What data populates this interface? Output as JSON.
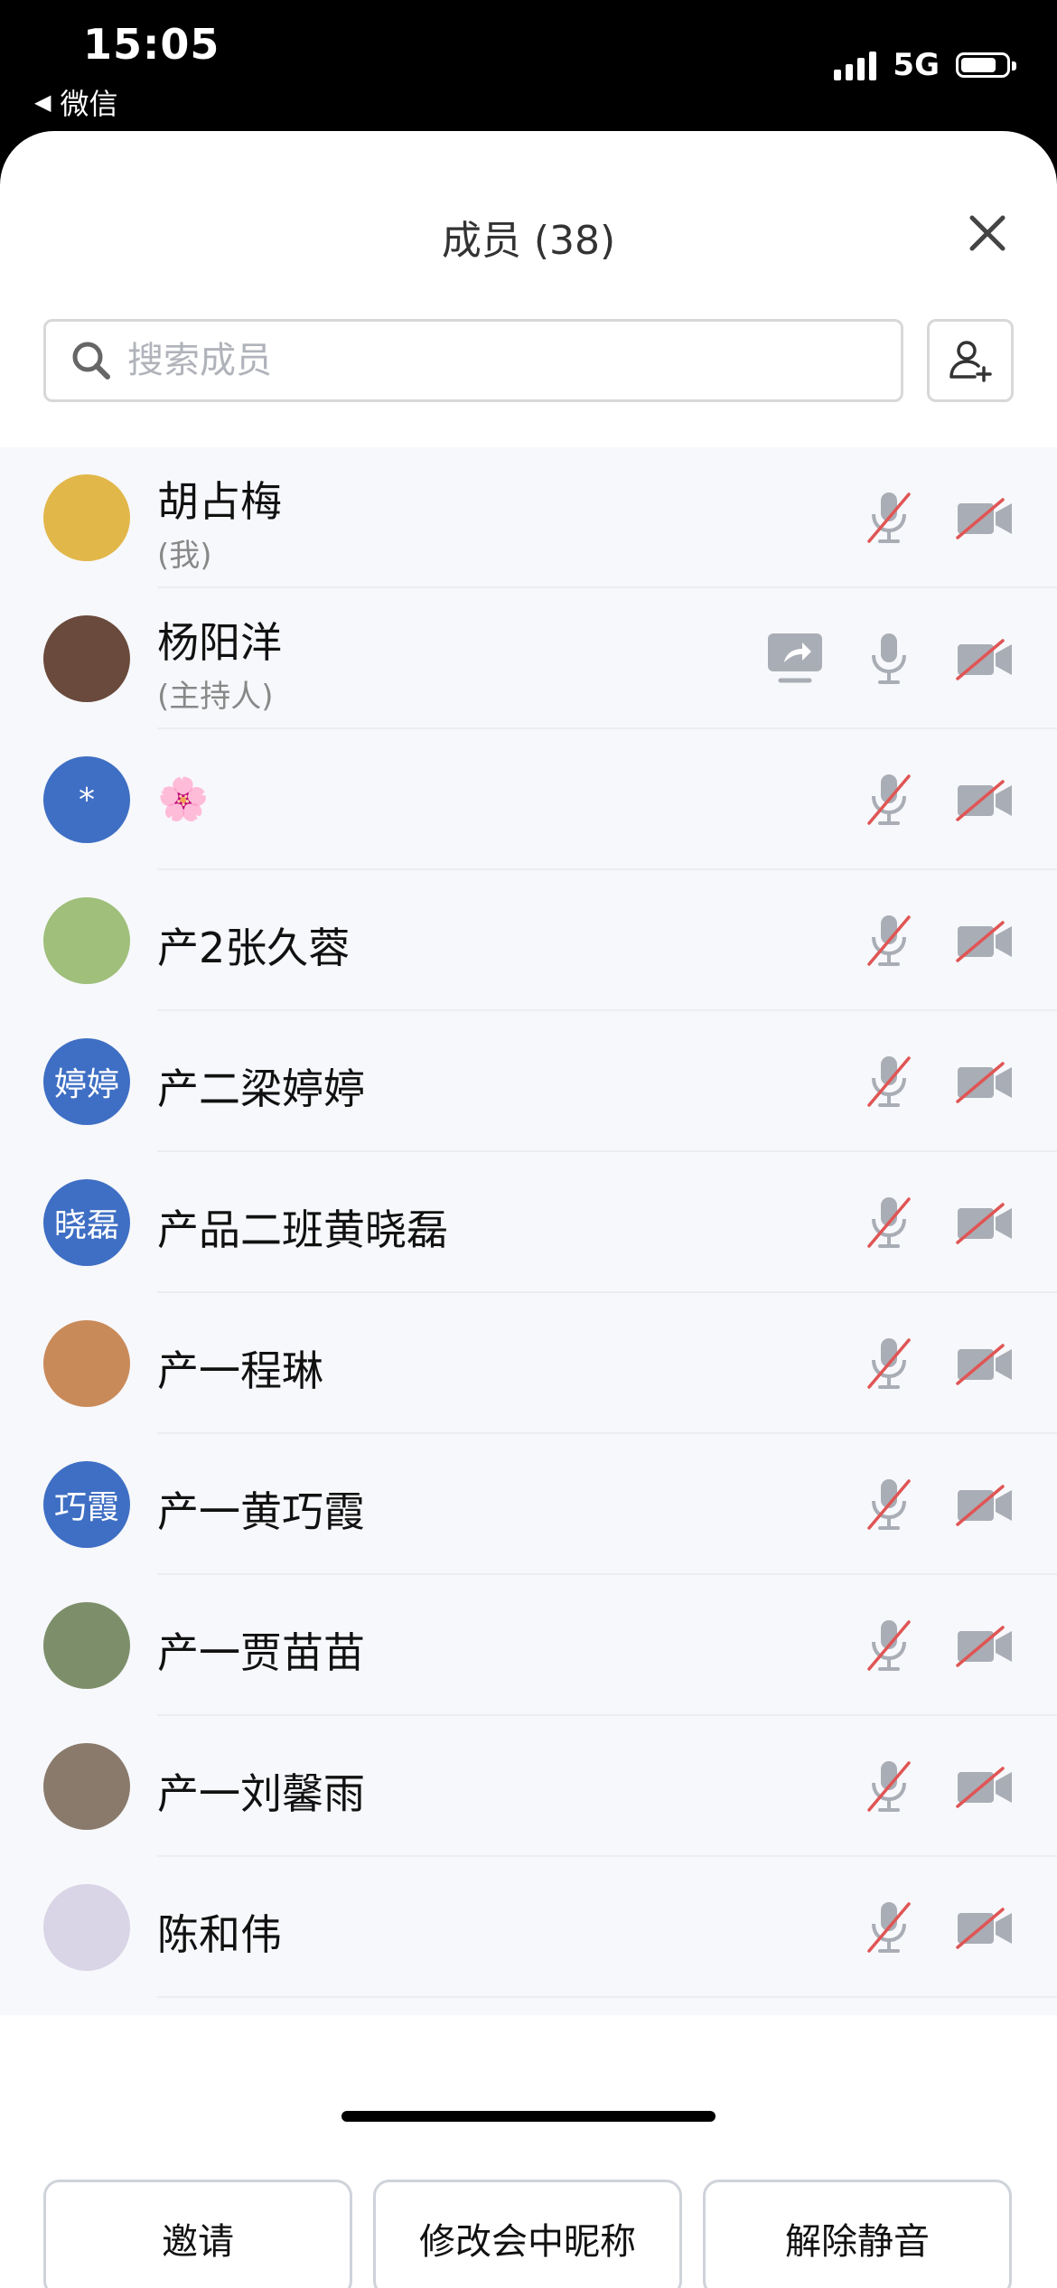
{
  "status_bar": {
    "time": "15:05",
    "back_app": "微信",
    "network": "5G"
  },
  "header": {
    "title": "成员 (38)"
  },
  "search": {
    "placeholder": "搜索成员"
  },
  "members": [
    {
      "name": "胡占梅",
      "role": "(我)",
      "avatar_text": "",
      "avatar_color": "#e2b74a",
      "mic": "muted",
      "camera": "off"
    },
    {
      "name": "杨阳洋",
      "role": "(主持人)",
      "avatar_text": "",
      "avatar_color": "#6a4a3c",
      "mic": "on",
      "camera": "off",
      "sharing": true
    },
    {
      "name": "🌸",
      "role": "",
      "avatar_text": "*",
      "avatar_color": "#3f6fc4",
      "mic": "muted",
      "camera": "off"
    },
    {
      "name": "产2张久蓉",
      "role": "",
      "avatar_text": "",
      "avatar_color": "#9fbf7a",
      "mic": "muted",
      "camera": "off"
    },
    {
      "name": "产二梁婷婷",
      "role": "",
      "avatar_text": "婷婷",
      "avatar_color": "#3f6fc4",
      "mic": "muted",
      "camera": "off"
    },
    {
      "name": "产品二班黄晓磊",
      "role": "",
      "avatar_text": "晓磊",
      "avatar_color": "#3f6fc4",
      "mic": "muted",
      "camera": "off"
    },
    {
      "name": "产一程琳",
      "role": "",
      "avatar_text": "",
      "avatar_color": "#c98a5a",
      "mic": "muted",
      "camera": "off"
    },
    {
      "name": "产一黄巧霞",
      "role": "",
      "avatar_text": "巧霞",
      "avatar_color": "#3f6fc4",
      "mic": "muted",
      "camera": "off"
    },
    {
      "name": "产一贾苗苗",
      "role": "",
      "avatar_text": "",
      "avatar_color": "#7d8f6a",
      "mic": "muted",
      "camera": "off"
    },
    {
      "name": "产一刘馨雨",
      "role": "",
      "avatar_text": "",
      "avatar_color": "#8a7a6c",
      "mic": "muted",
      "camera": "off"
    },
    {
      "name": "陈和伟",
      "role": "",
      "avatar_text": "",
      "avatar_color": "#d9d4e6",
      "mic": "muted",
      "camera": "off"
    }
  ],
  "footer": {
    "invite_label": "邀请",
    "rename_label": "修改会中昵称",
    "unmute_label": "解除静音"
  },
  "colors": {
    "accent_blue": "#3f6fc4",
    "muted_red": "#e05555",
    "icon_gray": "#a9adb5"
  }
}
